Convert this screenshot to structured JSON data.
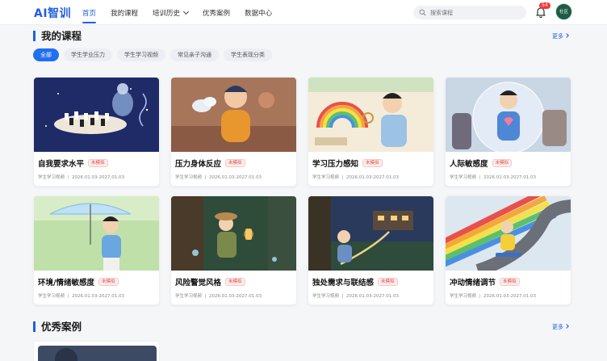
{
  "header": {
    "logo": "AI智训",
    "nav": [
      {
        "label": "首页",
        "active": true
      },
      {
        "label": "我的课程",
        "active": false
      },
      {
        "label": "培训历史",
        "active": false,
        "dropdown": true
      },
      {
        "label": "优秀案例",
        "active": false
      },
      {
        "label": "数据中心",
        "active": false
      }
    ],
    "search_placeholder": "搜索课程",
    "notification_count": "54",
    "avatar_label": "社区"
  },
  "courses": {
    "title": "我的课程",
    "more": "更多",
    "filters": [
      {
        "label": "全部",
        "active": true
      },
      {
        "label": "学生学业压力",
        "active": false
      },
      {
        "label": "学生学习视频",
        "active": false
      },
      {
        "label": "常见亲子沟通",
        "active": false
      },
      {
        "label": "学生表现分类",
        "active": false
      }
    ],
    "items": [
      {
        "title": "自我要求水平",
        "tag": "未模拟",
        "category": "学生学习视频",
        "date": "2026.01.03-2027.01.03",
        "theme": "chess"
      },
      {
        "title": "压力身体反应",
        "tag": "未模拟",
        "category": "学生学习视频",
        "date": "2026.01.03-2027.01.03",
        "theme": "stress"
      },
      {
        "title": "学习压力感知",
        "tag": "未模拟",
        "category": "学生学习视频",
        "date": "2026.01.03-2027.01.03",
        "theme": "rainbow-desk"
      },
      {
        "title": "人际敏感度",
        "tag": "未模拟",
        "category": "学生学习视频",
        "date": "2026.01.03-2027.01.03",
        "theme": "bubble"
      },
      {
        "title": "环境/情绪敏感度",
        "tag": "未模拟",
        "category": "学生学习视频",
        "date": "2026.01.03-2027.01.03",
        "theme": "umbrella"
      },
      {
        "title": "风险警觉风格",
        "tag": "未模拟",
        "category": "学生学习视频",
        "date": "2026.01.03-2027.01.03",
        "theme": "forest"
      },
      {
        "title": "独处需求与联结感",
        "tag": "未模拟",
        "category": "学生学习视频",
        "date": "2026.01.03-2027.01.03",
        "theme": "reading"
      },
      {
        "title": "冲动情绪调节",
        "tag": "未模拟",
        "category": "学生学习视频",
        "date": "2026.01.03-2027.01.03",
        "theme": "skate"
      }
    ]
  },
  "cases": {
    "title": "优秀案例",
    "more": "更多"
  },
  "colors": {
    "accent": "#1f5fe0",
    "tag_text": "#e0524e",
    "badge": "#ee3a3a"
  }
}
